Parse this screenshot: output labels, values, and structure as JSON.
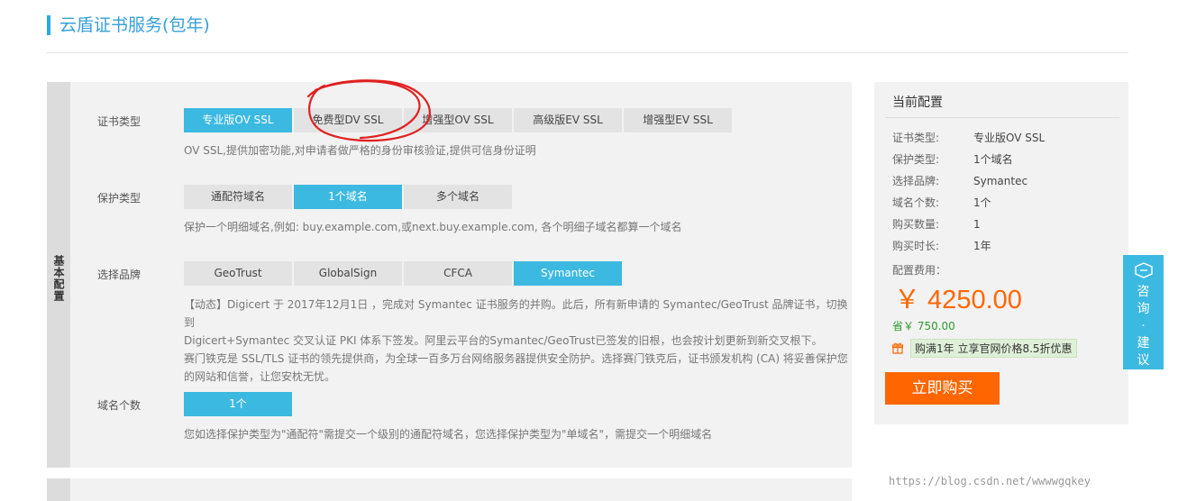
{
  "page": {
    "title": "云盾证书服务(包年)"
  },
  "config": {
    "side_label": "基本配置",
    "cert_type": {
      "label": "证书类型",
      "options": [
        "专业版OV SSL",
        "免费型DV SSL",
        "增强型OV SSL",
        "高级版EV SSL",
        "增强型EV SSL"
      ],
      "selected": "专业版OV SSL",
      "desc": "OV SSL,提供加密功能,对申请者做严格的身份审核验证,提供可信身份证明"
    },
    "protect_type": {
      "label": "保护类型",
      "options": [
        "通配符域名",
        "1个域名",
        "多个域名"
      ],
      "selected": "1个域名",
      "desc": "保护一个明细域名,例如: buy.example.com,或next.buy.example.com, 各个明细子域名都算一个域名"
    },
    "brand": {
      "label": "选择品牌",
      "options": [
        "GeoTrust",
        "GlobalSign",
        "CFCA",
        "Symantec"
      ],
      "selected": "Symantec",
      "desc_lines": [
        "【动态】Digicert 于 2017年12月1日 ，完成对 Symantec 证书服务的并购。此后，所有新申请的 Symantec/GeoTrust 品牌证书，切换到",
        "Digicert+Symantec 交叉认证 PKI 体系下签发。阿里云平台的Symantec/GeoTrust已签发的旧根，也会按计划更新到新交叉根下。",
        "赛门铁克是 SSL/TLS 证书的领先提供商，为全球一百多万台网络服务器提供安全防护。选择赛门铁克后，证书颁发机构 (CA) 将妥善保护您",
        "的网站和信誉，让您安枕无忧。"
      ]
    },
    "domain_count": {
      "label": "域名个数",
      "value": "1个",
      "desc": "您如选择保护类型为\"通配符\"需提交一个级别的通配符域名，您选择保护类型为\"单域名\"，需提交一个明细域名"
    }
  },
  "summary": {
    "title": "当前配置",
    "rows": [
      {
        "key": "证书类型:",
        "value": "专业版OV SSL"
      },
      {
        "key": "保护类型:",
        "value": "1个域名"
      },
      {
        "key": "选择品牌:",
        "value": "Symantec"
      },
      {
        "key": "域名个数:",
        "value": "1个"
      },
      {
        "key": "购买数量:",
        "value": "1"
      },
      {
        "key": "购买时长:",
        "value": "1年"
      }
    ],
    "fee_label": "配置费用：",
    "price": "￥ 4250.00",
    "save": "省￥ 750.00",
    "promo": "购满1年 立享官网价格8.5折优惠",
    "buy_label": "立即购买"
  },
  "side_float": {
    "text": "咨询·建议"
  },
  "watermark": "https://blog.csdn.net/wwwwgqkey",
  "colors": {
    "accent": "#3cb9e0",
    "buy": "#ff6600",
    "price": "#ff6600",
    "annotation": "#e02020"
  }
}
